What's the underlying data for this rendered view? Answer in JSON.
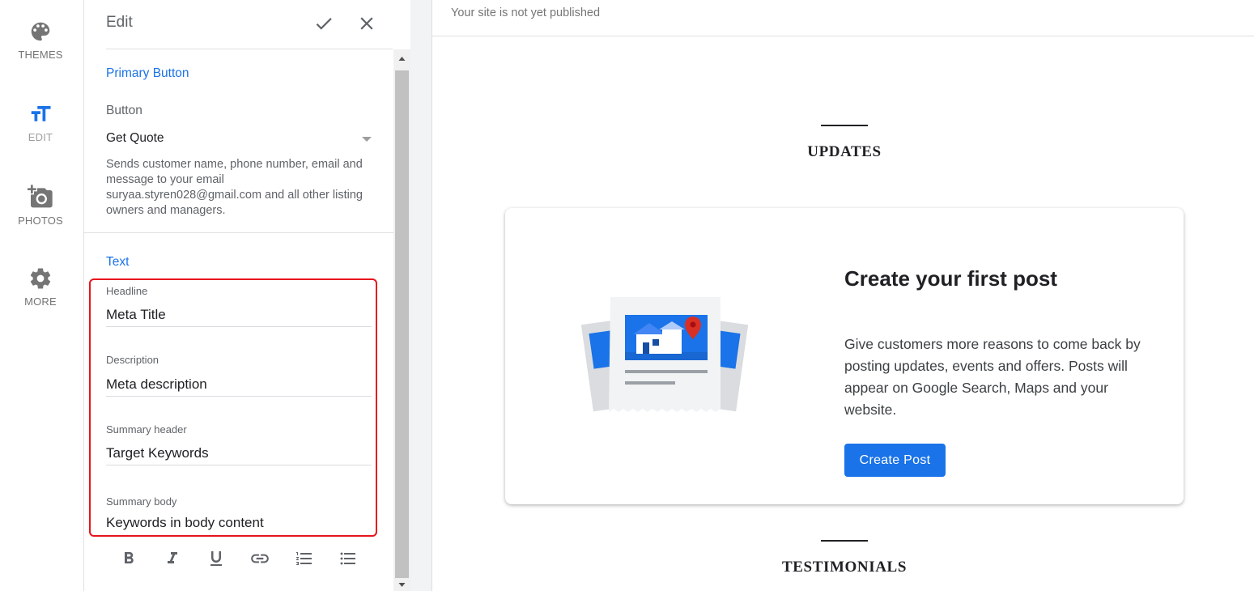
{
  "rail": {
    "items": [
      {
        "label": "THEMES",
        "icon": "palette-icon"
      },
      {
        "label": "EDIT",
        "icon": "text-size-icon"
      },
      {
        "label": "PHOTOS",
        "icon": "add-photo-icon"
      },
      {
        "label": "MORE",
        "icon": "gear-icon"
      }
    ]
  },
  "panel": {
    "title": "Edit",
    "confirm_icon": "check-icon",
    "close_icon": "close-icon",
    "primary_button": {
      "section_title": "Primary Button",
      "button_label": "Button",
      "selected_value": "Get Quote",
      "helper": "Sends customer name, phone number, email and message to your email suryaa.styren028@gmail.com and all other listing owners and managers."
    },
    "text_section": {
      "section_title": "Text",
      "fields": [
        {
          "label": "Headline",
          "value": "Meta Title"
        },
        {
          "label": "Description",
          "value": "Meta description"
        },
        {
          "label": "Summary header",
          "value": "Target Keywords"
        },
        {
          "label": "Summary body",
          "value": "Keywords in body content"
        }
      ]
    },
    "format_toolbar": [
      "bold-icon",
      "italic-icon",
      "underline-icon",
      "link-icon",
      "numbered-list-icon",
      "bulleted-list-icon"
    ]
  },
  "preview": {
    "status": "Your site is not yet published",
    "updates_heading": "UPDATES",
    "card": {
      "title": "Create your first post",
      "body": "Give customers more reasons to come back by posting updates, events and offers. Posts will appear on Google Search, Maps and your website.",
      "button": "Create Post"
    },
    "testimonials_heading": "TESTIMONIALS"
  },
  "colors": {
    "accent": "#1a73e8",
    "highlight": "#e8141c",
    "muted_text": "#5f6368",
    "map_pin": "#d93025"
  }
}
